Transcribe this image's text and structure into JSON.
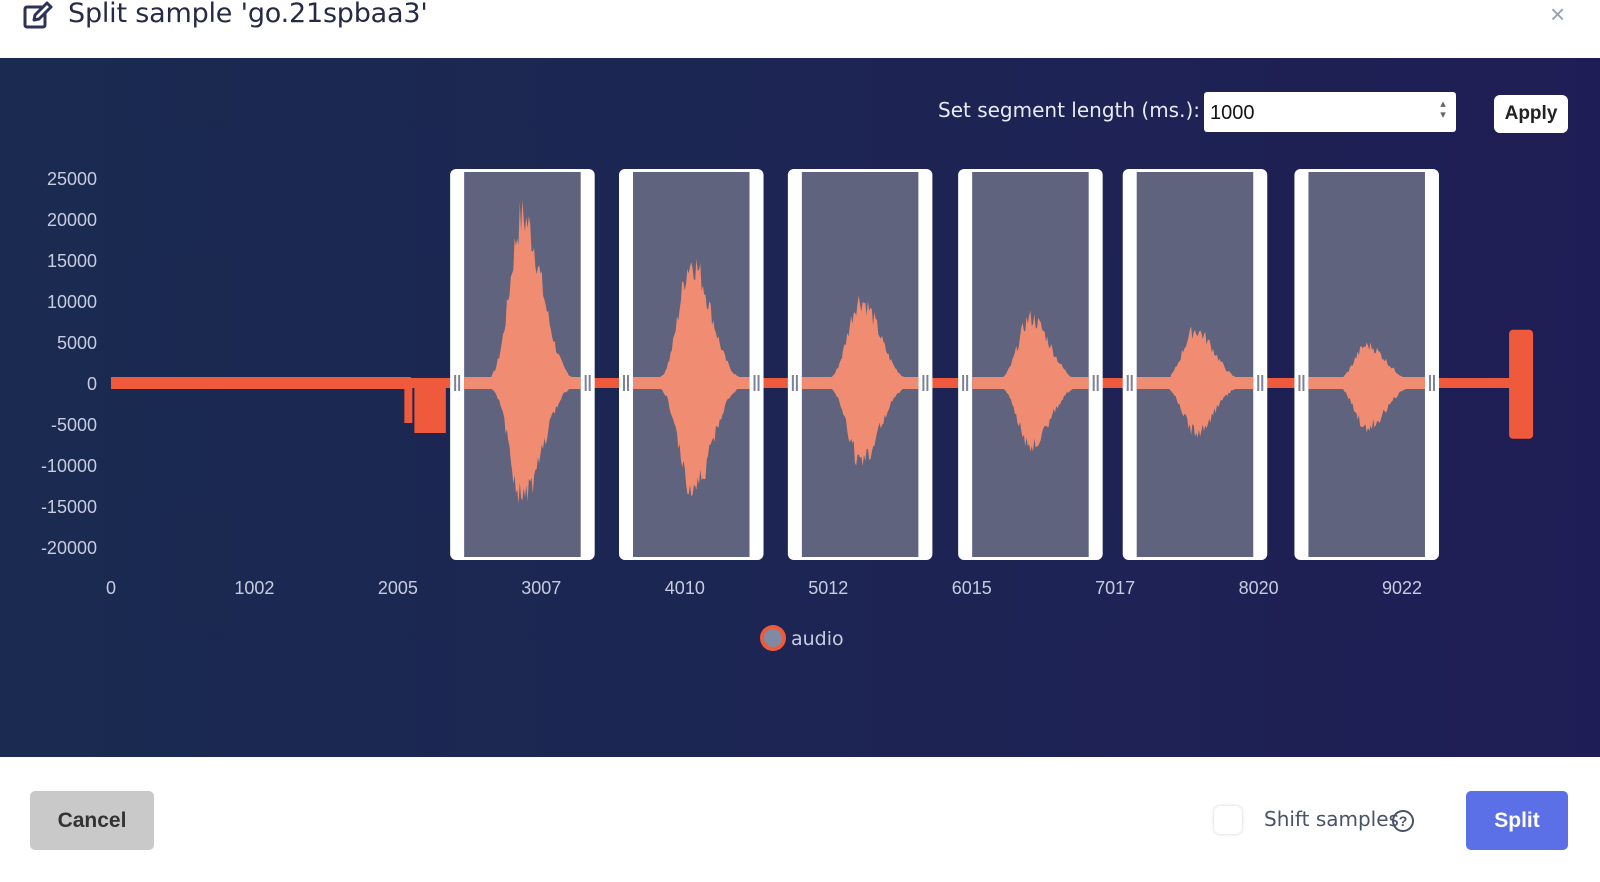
{
  "dialog": {
    "title": "Split sample 'go.21spbaa3'",
    "close_symbol": "×",
    "edit_icon": "edit-icon"
  },
  "segment_control": {
    "label": "Set segment length (ms.):",
    "value": "1000",
    "apply_label": "Apply"
  },
  "chart_data": {
    "type": "line",
    "series": [
      {
        "name": "audio",
        "color": "#f05a3c"
      }
    ],
    "x_ticks": [
      "0",
      "1002",
      "2005",
      "3007",
      "4010",
      "5012",
      "6015",
      "7017",
      "8020",
      "9022"
    ],
    "y_ticks": [
      "25000",
      "20000",
      "15000",
      "10000",
      "5000",
      "0",
      "-5000",
      "-10000",
      "-15000",
      "-20000"
    ],
    "xlim": [
      0,
      10000
    ],
    "ylim": [
      -20000,
      25000
    ],
    "segments": [
      {
        "start": 2370,
        "end": 3380,
        "peak": 23000,
        "trough": -16500
      },
      {
        "start": 3550,
        "end": 4560,
        "peak": 16800,
        "trough": -15500
      },
      {
        "start": 4730,
        "end": 5740,
        "peak": 11500,
        "trough": -10800
      },
      {
        "start": 5920,
        "end": 6930,
        "peak": 9000,
        "trough": -8800
      },
      {
        "start": 7070,
        "end": 8080,
        "peak": 7300,
        "trough": -6800
      },
      {
        "start": 8270,
        "end": 9280,
        "peak": 5200,
        "trough": -6200
      }
    ],
    "legend_position": "bottom-center"
  },
  "footer": {
    "cancel_label": "Cancel",
    "shift_label": "Shift samples",
    "help_symbol": "?",
    "split_label": "Split"
  }
}
